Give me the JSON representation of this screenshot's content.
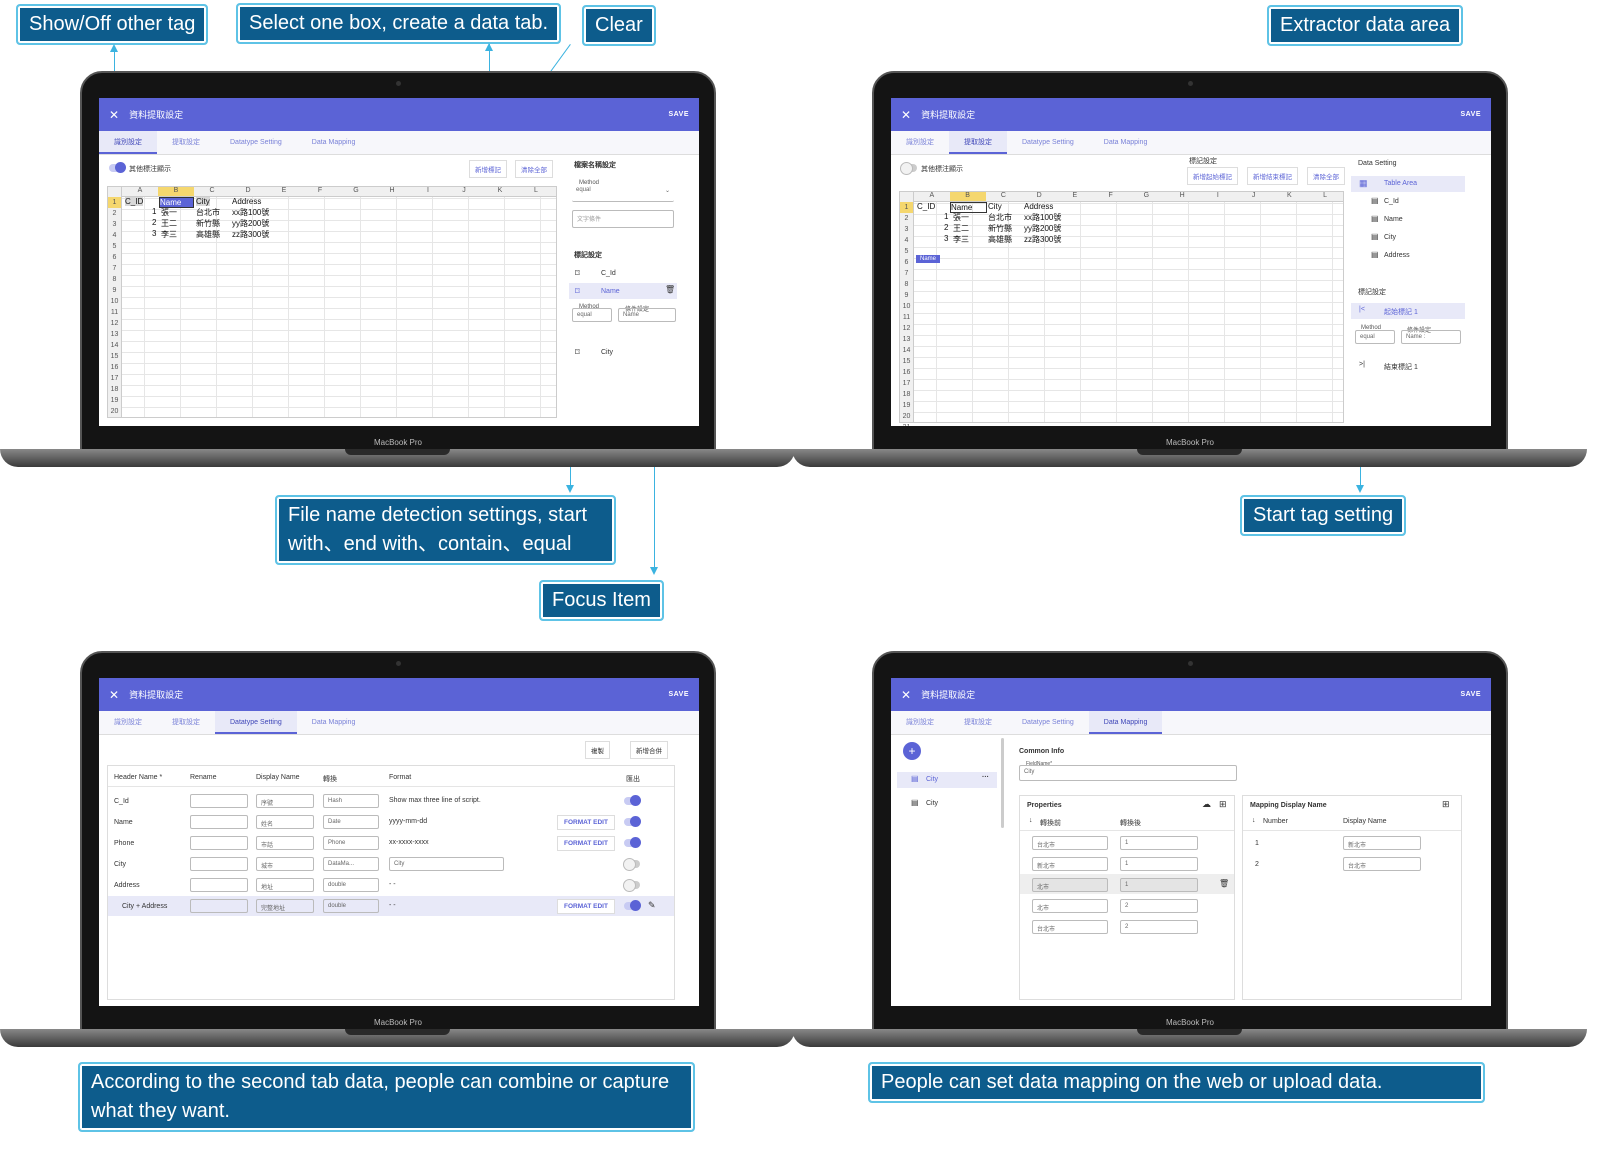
{
  "callouts": {
    "show_off": "Show/Off other tag",
    "select_box": "Select one box, create a data tab.",
    "clear": "Clear",
    "extractor": "Extractor data area",
    "file_name": "File name detection settings, start with、end with、contain、equal",
    "focus_item": "Focus Item",
    "start_tag": "Start tag setting",
    "combine": "According to the second tab data, people can combine or capture what they want.",
    "mapping": "People can set data mapping on the web or upload data."
  },
  "app": {
    "title": "資料提取設定",
    "save": "SAVE",
    "close": "✕",
    "laptop_brand": "MacBook Pro",
    "tabs": [
      "識別設定",
      "提取設定",
      "Datatype Setting",
      "Data Mapping"
    ]
  },
  "sheet": {
    "columns": [
      "A",
      "B",
      "C",
      "D",
      "E",
      "F",
      "G",
      "H",
      "I",
      "J",
      "K",
      "L"
    ],
    "rows": [
      "1",
      "2",
      "3",
      "4",
      "5",
      "6",
      "7",
      "8",
      "9",
      "10",
      "11",
      "12",
      "13",
      "14",
      "15",
      "16",
      "17",
      "18",
      "19",
      "20",
      "21"
    ],
    "header": [
      "C_ID",
      "Name",
      "City",
      "Address"
    ],
    "data": [
      [
        "1",
        "張一",
        "台北市",
        "xx路100號"
      ],
      [
        "2",
        "王二",
        "新竹縣",
        "yy路200號"
      ],
      [
        "3",
        "李三",
        "高雄縣",
        "zz路300號"
      ]
    ],
    "tag_chip": "Name"
  },
  "screen1": {
    "toggle_label": "其他標注顯示",
    "add_tag": "新增標記",
    "clear_all": "清除全部",
    "file_setting_title": "檔案名稱設定",
    "method_label": "Method",
    "method_value": "equal",
    "text_cond_placeholder": "文字條件",
    "tag_setting_title": "標記設定",
    "tags": [
      "C_Id",
      "Name",
      "City"
    ],
    "cond_label": "條件設定",
    "cond_value": "Name"
  },
  "screen2": {
    "toggle_label": "其他標注顯示",
    "tag_setting": "標記設定",
    "add_start": "新增起始標記",
    "add_end": "新增結束標記",
    "clear_all": "清除全部",
    "data_setting": "Data Setting",
    "table_area": "Table Area",
    "fields": [
      "C_Id",
      "Name",
      "City",
      "Address"
    ],
    "tag_setting_title": "標記設定",
    "start_tag": "起始標記 1",
    "method_label": "Method",
    "method_value": "equal",
    "cond_label": "條件設定",
    "cond_value": "Name :",
    "end_tag": "結束標記 1"
  },
  "screen3": {
    "copy": "複製",
    "add_merge": "新增合併",
    "headers": [
      "Header Name *",
      "Rename",
      "Display Name",
      "轉換",
      "Format",
      "匯出"
    ],
    "rows": [
      {
        "name": "C_Id",
        "display": "序號",
        "type": "Hash",
        "format": "Show max three line of script.",
        "edit": "",
        "on": true
      },
      {
        "name": "Name",
        "display": "姓名",
        "type": "Date",
        "format": "yyyy-mm-dd",
        "edit": "FORMAT EDIT",
        "on": true
      },
      {
        "name": "Phone",
        "display": "市話",
        "type": "Phone",
        "format": "xx-xxxx-xxxx",
        "edit": "FORMAT EDIT",
        "on": true
      },
      {
        "name": "City",
        "display": "城市",
        "type": "DataMa...",
        "format": "City",
        "edit": "",
        "on": false
      },
      {
        "name": "Address",
        "display": "地址",
        "type": "double",
        "format": "- -",
        "edit": "",
        "on": false
      },
      {
        "name": "City + Address",
        "display": "完整地址",
        "type": "double",
        "format": "- -",
        "edit": "FORMAT EDIT",
        "on": true
      }
    ]
  },
  "screen4": {
    "files": [
      "City",
      "City"
    ],
    "common_info": "Common Info",
    "field_name_label": "FieldName*",
    "field_name_value": "City",
    "properties": "Properties",
    "before": "轉換前",
    "after": "轉換後",
    "prop_rows": [
      [
        "台北市",
        "1"
      ],
      [
        "新北市",
        "1"
      ],
      [
        "北市",
        "1"
      ],
      [
        "北市",
        "2"
      ],
      [
        "台北市",
        "2"
      ]
    ],
    "mapping_title": "Mapping Display Name",
    "number": "Number",
    "display_name": "Display Name",
    "map_rows": [
      [
        "1",
        "新北市"
      ],
      [
        "2",
        "台北市"
      ]
    ]
  }
}
